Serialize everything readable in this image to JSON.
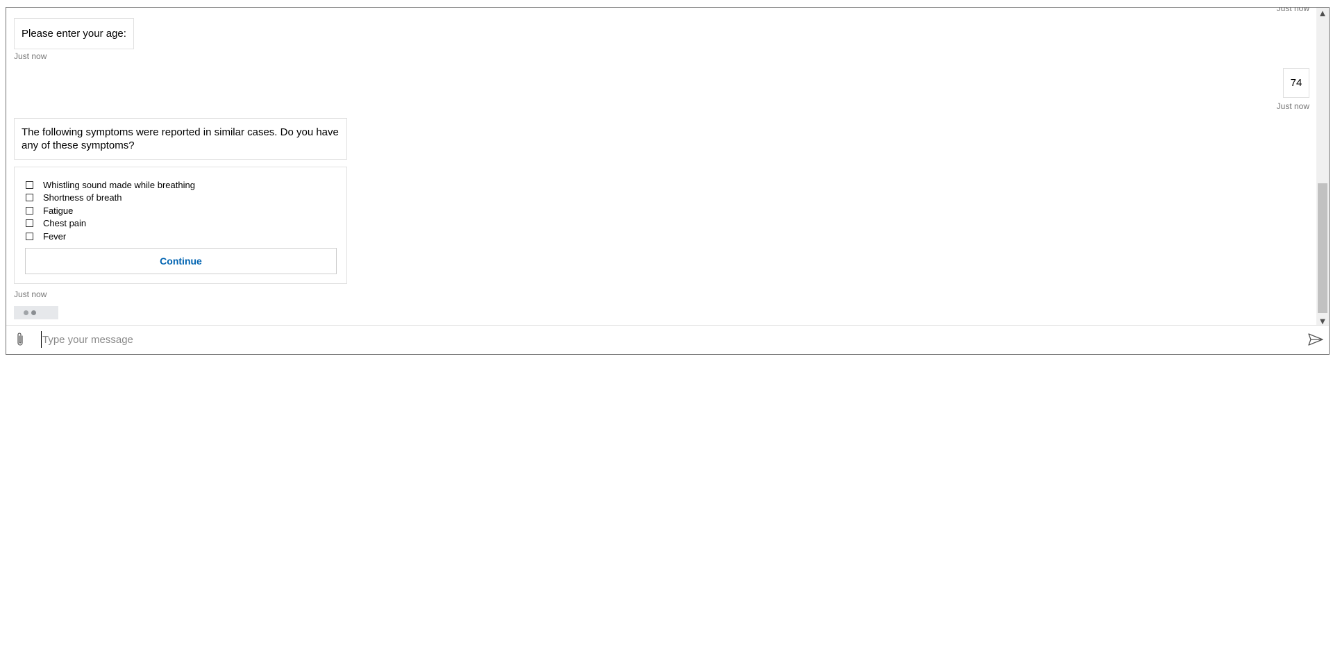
{
  "transcript": {
    "clipped_timestamp": "Just now",
    "messages": [
      {
        "from": "bot",
        "text": "Please enter your age:",
        "timestamp": "Just now"
      },
      {
        "from": "user",
        "text": "74",
        "timestamp": "Just now"
      },
      {
        "from": "bot",
        "text": "The following symptoms were reported in similar cases. Do you have any of these symptoms?"
      }
    ],
    "symptom_card": {
      "options": [
        {
          "label": "Whistling sound made while breathing",
          "checked": false
        },
        {
          "label": "Shortness of breath",
          "checked": false
        },
        {
          "label": "Fatigue",
          "checked": false
        },
        {
          "label": "Chest pain",
          "checked": false
        },
        {
          "label": "Fever",
          "checked": false
        }
      ],
      "continue_label": "Continue",
      "timestamp": "Just now"
    },
    "typing_indicator_icon": "typing-dots"
  },
  "input_bar": {
    "placeholder": "Type your message",
    "value": "",
    "attach_icon": "paperclip-icon",
    "send_icon": "send-icon"
  },
  "colors": {
    "accent": "#0063b1",
    "timestamp": "#767676",
    "bubble_border": "#e0e0e0",
    "typing_bg": "#e6e8eb"
  }
}
